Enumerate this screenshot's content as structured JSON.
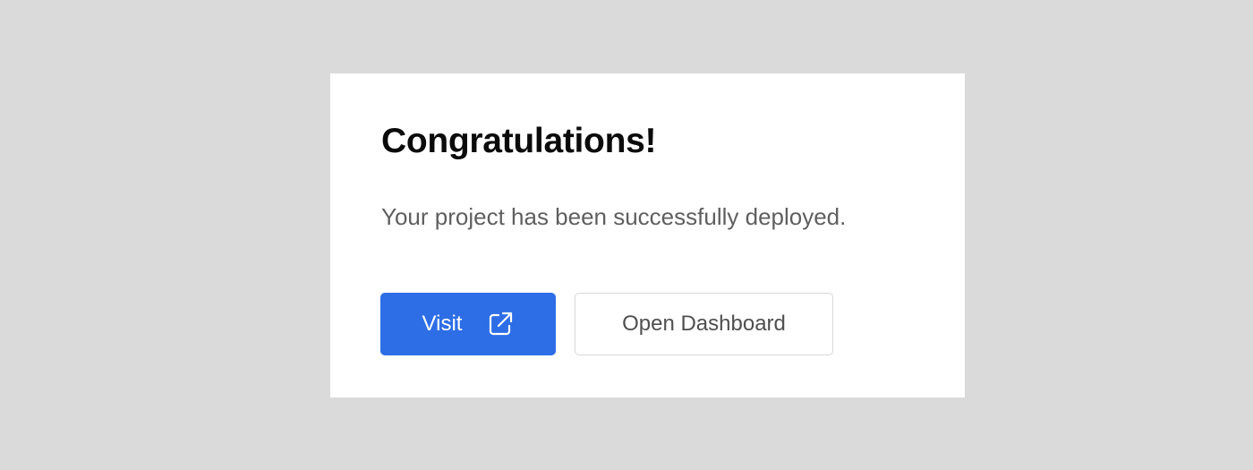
{
  "dialog": {
    "title": "Congratulations!",
    "message": "Your project has been successfully deployed."
  },
  "actions": {
    "visit_label": "Visit",
    "visit_icon": "external-link-icon",
    "dashboard_label": "Open Dashboard"
  },
  "colors": {
    "background": "#dadada",
    "card": "#ffffff",
    "primary": "#2d6ee6",
    "title_text": "#0b0b0b",
    "body_text": "#5f5f5f"
  }
}
